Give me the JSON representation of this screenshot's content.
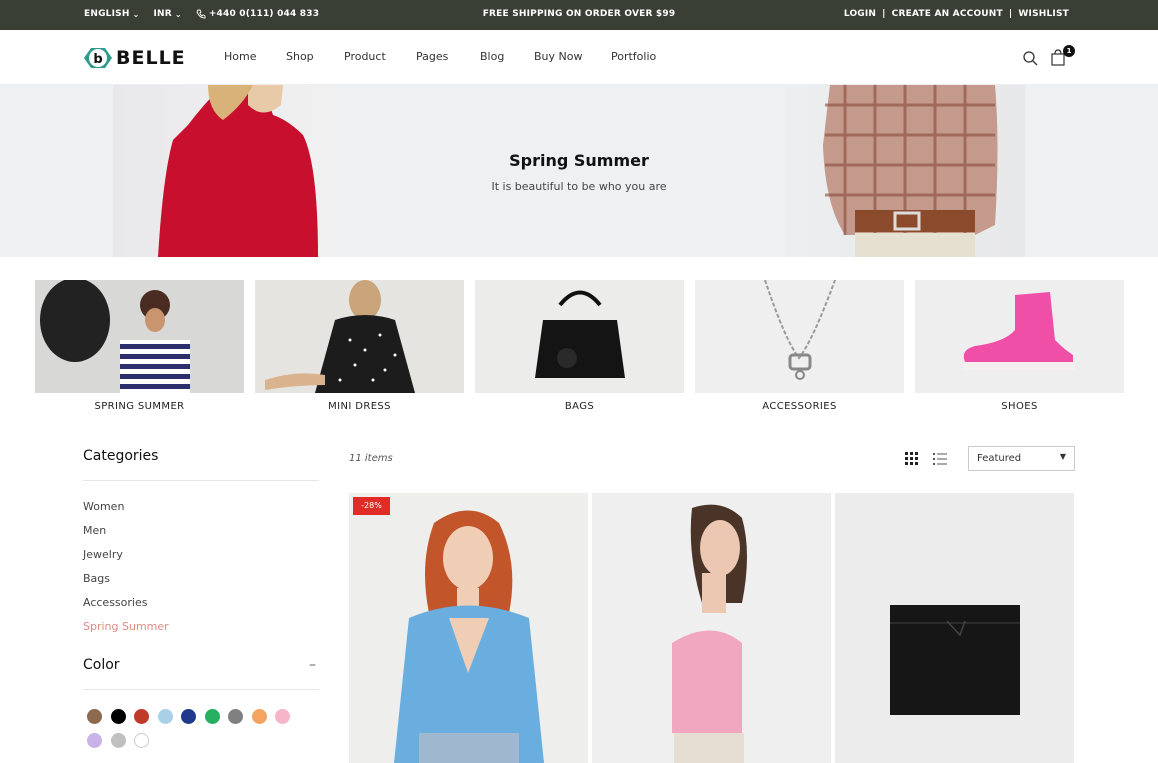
{
  "topbar": {
    "language": "ENGLISH",
    "currency": "INR",
    "phone": "+440 0(111) 044 833",
    "promo": "FREE SHIPPING ON ORDER OVER $99",
    "links": [
      "LOGIN",
      "|",
      "CREATE AN ACCOUNT",
      "|",
      "WISHLIST"
    ]
  },
  "header": {
    "logo_text": "BELLE",
    "nav": [
      "Home",
      "Shop",
      "Product",
      "Pages",
      "Blog",
      "Buy Now",
      "Portfolio"
    ],
    "cart_count": "1"
  },
  "hero": {
    "title": "Spring Summer",
    "subtitle": "It is beautiful to be who you are"
  },
  "categories_strip": [
    "SPRING SUMMER",
    "MINI DRESS",
    "BAGS",
    "ACCESSORIES",
    "SHOES"
  ],
  "sidebar": {
    "categories_title": "Categories",
    "categories": [
      "Women",
      "Men",
      "Jewelry",
      "Bags",
      "Accessories",
      "Spring Summer"
    ],
    "active_category": "Spring Summer",
    "color_title": "Color",
    "color_toggle": "–",
    "swatches": [
      "#8b6a4f",
      "#000000",
      "#c0392b",
      "#a8d0e6",
      "#1f3a8a",
      "#27ae60",
      "#808080",
      "#f4a460",
      "#f7b6c8",
      "#c7b3e6",
      "#c0c0c0",
      "#ffffff"
    ]
  },
  "toolbar": {
    "items_count": "11 items",
    "sort_value": "Featured"
  },
  "products": [
    {
      "badge": "-28%"
    },
    {
      "badge": ""
    },
    {
      "badge": ""
    }
  ],
  "colors": {
    "topbar_bg": "#3a3f35",
    "accent_pink": "#e08a84",
    "sale_red": "#e02b27",
    "logo_teal": "#2f9a8a"
  }
}
